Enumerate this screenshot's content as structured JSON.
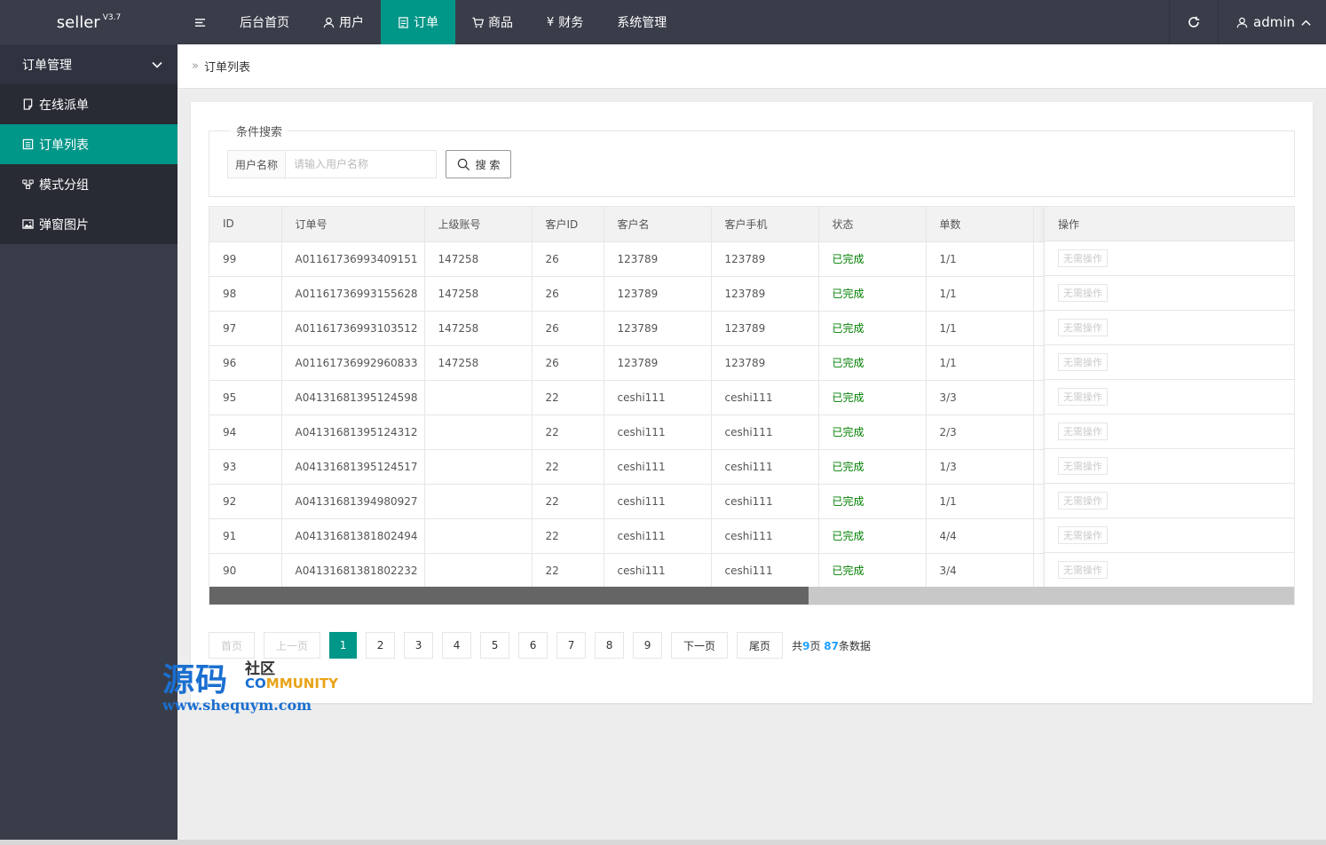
{
  "app": {
    "title": "seller",
    "version": "V3.7"
  },
  "topnav": {
    "items": [
      {
        "label": "后台首页",
        "icon": ""
      },
      {
        "label": "用户",
        "icon": "user-icon"
      },
      {
        "label": "订单",
        "icon": "document-icon",
        "active": true
      },
      {
        "label": "商品",
        "icon": "cart-icon"
      },
      {
        "label": "财务",
        "icon": "yen-icon"
      },
      {
        "label": "系统管理",
        "icon": ""
      }
    ],
    "user": "admin"
  },
  "sidebar": {
    "group": "订单管理",
    "items": [
      {
        "label": "在线派单",
        "icon": "document-icon"
      },
      {
        "label": "订单列表",
        "icon": "list-icon",
        "active": true
      },
      {
        "label": "模式分组",
        "icon": "sitemap-icon"
      },
      {
        "label": "弹窗图片",
        "icon": "image-icon"
      }
    ]
  },
  "breadcrumb": {
    "current": "订单列表"
  },
  "search": {
    "legend": "条件搜索",
    "label": "用户名称",
    "placeholder": "请输入用户名称",
    "value": "",
    "button": "搜 索"
  },
  "table": {
    "columns": [
      "ID",
      "订单号",
      "上级账号",
      "客户ID",
      "客户名",
      "客户手机",
      "状态",
      "单数"
    ],
    "action_header": "操作",
    "rows": [
      [
        "99",
        "A01161736993409151",
        "147258",
        "26",
        "123789",
        "123789",
        "已完成",
        "1/1"
      ],
      [
        "98",
        "A01161736993155628",
        "147258",
        "26",
        "123789",
        "123789",
        "已完成",
        "1/1"
      ],
      [
        "97",
        "A01161736993103512",
        "147258",
        "26",
        "123789",
        "123789",
        "已完成",
        "1/1"
      ],
      [
        "96",
        "A01161736992960833",
        "147258",
        "26",
        "123789",
        "123789",
        "已完成",
        "1/1"
      ],
      [
        "95",
        "A04131681395124598",
        "",
        "22",
        "ceshi111",
        "ceshi111",
        "已完成",
        "3/3"
      ],
      [
        "94",
        "A04131681395124312",
        "",
        "22",
        "ceshi111",
        "ceshi111",
        "已完成",
        "2/3"
      ],
      [
        "93",
        "A04131681395124517",
        "",
        "22",
        "ceshi111",
        "ceshi111",
        "已完成",
        "1/3"
      ],
      [
        "92",
        "A04131681394980927",
        "",
        "22",
        "ceshi111",
        "ceshi111",
        "已完成",
        "1/1"
      ],
      [
        "91",
        "A04131681381802494",
        "",
        "22",
        "ceshi111",
        "ceshi111",
        "已完成",
        "4/4"
      ],
      [
        "90",
        "A04131681381802232",
        "",
        "22",
        "ceshi111",
        "ceshi111",
        "已完成",
        "3/4"
      ]
    ],
    "action_label": "无需操作",
    "status_color": "#008000"
  },
  "pager": {
    "first": "首页",
    "prev": "上一页",
    "pages": [
      "1",
      "2",
      "3",
      "4",
      "5",
      "6",
      "7",
      "8",
      "9"
    ],
    "current": "1",
    "next": "下一页",
    "last": "尾页",
    "info_prefix": "共",
    "total_pages": "9",
    "info_mid": "页",
    "total_records": "87",
    "info_suffix": "条数据"
  },
  "watermark": {
    "main": "源码",
    "sub": "社区",
    "community_a": "CO",
    "community_b": "MMUNITY",
    "url": "www.shequym.com"
  },
  "colors": {
    "accent": "#009688",
    "topbar": "#393d49",
    "link": "#1e9fff"
  }
}
